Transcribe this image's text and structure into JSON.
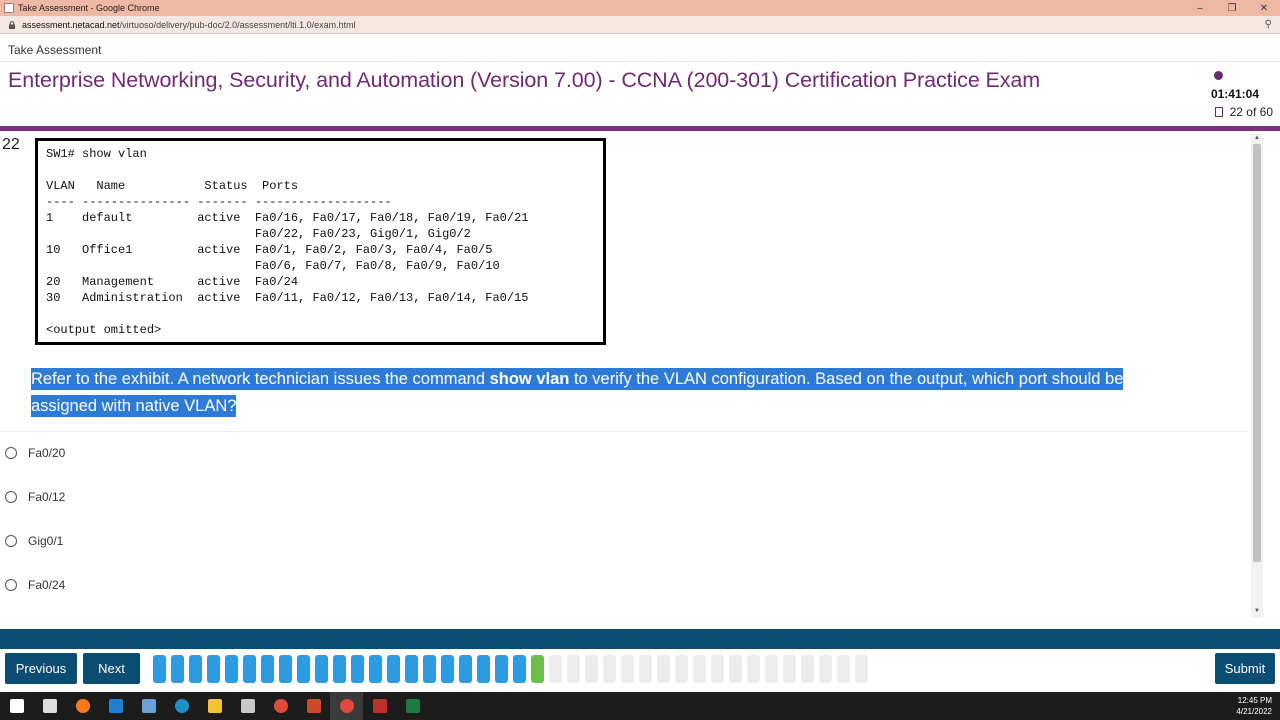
{
  "window": {
    "title": "Take Assessment - Google Chrome",
    "url_host": "assessment.netacad.net",
    "url_path": "/virtuoso/delivery/pub-doc/2.0/assessment/lti.1.0/exam.html"
  },
  "header": {
    "breadcrumb": "Take Assessment",
    "exam_title": "Enterprise Networking, Security, and Automation (Version 7.00) - CCNA (200-301) Certification Practice Exam",
    "timer": "01:41:04",
    "progress": "22 of 60"
  },
  "question": {
    "number": "22",
    "exhibit_lines": [
      "SW1# show vlan",
      "",
      "VLAN   Name           Status  Ports",
      "---- --------------- ------- -------------------",
      "1    default         active  Fa0/16, Fa0/17, Fa0/18, Fa0/19, Fa0/21",
      "                             Fa0/22, Fa0/23, Gig0/1, Gig0/2",
      "10   Office1         active  Fa0/1, Fa0/2, Fa0/3, Fa0/4, Fa0/5",
      "                             Fa0/6, Fa0/7, Fa0/8, Fa0/9, Fa0/10",
      "20   Management      active  Fa0/24",
      "30   Administration  active  Fa0/11, Fa0/12, Fa0/13, Fa0/14, Fa0/15",
      "",
      "<output omitted>"
    ],
    "prompt_before": "Refer to the exhibit. A network technician issues the command ",
    "prompt_bold": "show vlan",
    "prompt_after": " to verify the VLAN configuration. Based on the output, which port should be assigned with native VLAN?",
    "options": [
      "Fa0/20",
      "Fa0/12",
      "Gig0/1",
      "Fa0/24"
    ]
  },
  "nav": {
    "previous_label": "Previous",
    "next_label": "Next",
    "submit_label": "Submit",
    "steps_total": 60,
    "steps_answered": 21,
    "current_step": 22,
    "colors": {
      "answered": "#2e9be0",
      "current": "#6cbf4a",
      "unanswered": "#ececec"
    }
  },
  "taskbar": {
    "time": "12:45 PM",
    "date": "4/21/2022",
    "apps": [
      "windows-start-icon",
      "task-view-icon",
      "firefox-icon",
      "app-icon",
      "network-tool-icon",
      "edge-icon",
      "file-explorer-icon",
      "cisco-icon",
      "chrome-icon",
      "powerpoint-icon",
      "chrome-icon",
      "recorder-icon",
      "excel-icon"
    ]
  }
}
